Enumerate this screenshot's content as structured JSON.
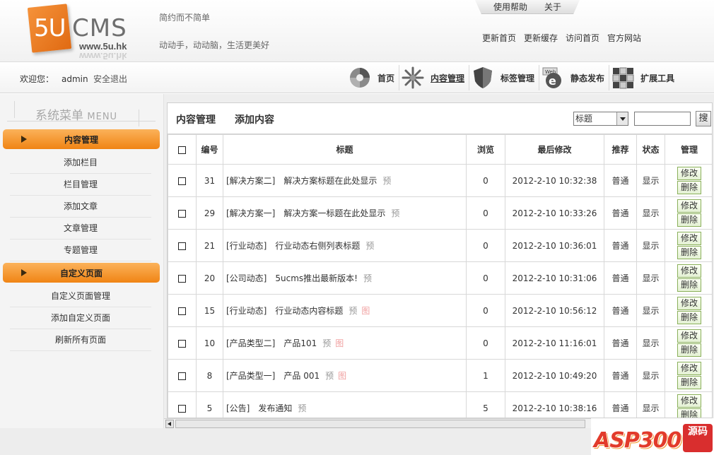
{
  "header": {
    "logo_5u": "5U",
    "logo_cms": "CMS",
    "logo_url": "www.5u.hk",
    "slogan1": "简约而不简单",
    "slogan2": "动动手，动动脑，生活更美好",
    "help_tab": [
      "使用帮助",
      "关于"
    ],
    "quick_links": [
      "更新首页",
      "更新缓存",
      "访问首页",
      "官方网站"
    ]
  },
  "navbar": {
    "welcome": "欢迎您：",
    "user": "admin",
    "logout": "安全退出",
    "items": [
      {
        "label": "首页",
        "icon": "home-icon"
      },
      {
        "label": "内容管理",
        "icon": "content-icon"
      },
      {
        "label": "标签管理",
        "icon": "tag-icon"
      },
      {
        "label": "静态发布",
        "icon": "publish-icon"
      },
      {
        "label": "扩展工具",
        "icon": "tools-icon"
      }
    ]
  },
  "sidebar": {
    "title": "系统菜单",
    "title_en": "MENU",
    "groups": [
      {
        "label": "内容管理",
        "items": [
          "添加栏目",
          "栏目管理",
          "添加文章",
          "文章管理",
          "专题管理"
        ]
      },
      {
        "label": "自定义页面",
        "items": [
          "自定义页面管理",
          "添加自定义页面",
          "刷新所有页面"
        ]
      }
    ]
  },
  "main": {
    "title": "内容管理",
    "add_link": "添加内容",
    "search_select": "标题",
    "search_button": "搜",
    "columns": [
      "编号",
      "标题",
      "浏览",
      "最后修改",
      "推荐",
      "状态",
      "管理"
    ],
    "edit_label": "修改",
    "delete_label": "删除",
    "rows": [
      {
        "id": "31",
        "cat": "[解决方案二]",
        "title": "解决方案标题在此处显示",
        "pre": "预",
        "pic": "",
        "views": "0",
        "modified": "2012-2-10 10:32:38",
        "rec": "普通",
        "status": "显示"
      },
      {
        "id": "29",
        "cat": "[解决方案一]",
        "title": "解决方案一标题在此处显示",
        "pre": "预",
        "pic": "",
        "views": "0",
        "modified": "2012-2-10 10:33:26",
        "rec": "普通",
        "status": "显示"
      },
      {
        "id": "21",
        "cat": "[行业动态]",
        "title": "行业动态右侧列表标题",
        "pre": "预",
        "pic": "",
        "views": "0",
        "modified": "2012-2-10 10:36:01",
        "rec": "普通",
        "status": "显示"
      },
      {
        "id": "20",
        "cat": "[公司动态]",
        "title": "5ucms推出最新版本!",
        "pre": "预",
        "pic": "",
        "views": "0",
        "modified": "2012-2-10 10:31:06",
        "rec": "普通",
        "status": "显示"
      },
      {
        "id": "15",
        "cat": "[行业动态]",
        "title": "行业动态内容标题",
        "pre": "预",
        "pic": "图",
        "views": "0",
        "modified": "2012-2-10 10:56:12",
        "rec": "普通",
        "status": "显示"
      },
      {
        "id": "10",
        "cat": "[产品类型二]",
        "title": "产品101",
        "pre": "预",
        "pic": "图",
        "views": "0",
        "modified": "2012-2-10 11:16:01",
        "rec": "普通",
        "status": "显示"
      },
      {
        "id": "8",
        "cat": "[产品类型一]",
        "title": "产品 001",
        "pre": "预",
        "pic": "图",
        "views": "1",
        "modified": "2012-2-10 10:49:20",
        "rec": "普通",
        "status": "显示"
      },
      {
        "id": "5",
        "cat": "[公告]",
        "title": "发布通知",
        "pre": "预",
        "pic": "",
        "views": "5",
        "modified": "2012-2-10 10:38:16",
        "rec": "普通",
        "status": "显示"
      }
    ]
  },
  "watermark": {
    "text": "ASP300",
    "badge": "源码"
  },
  "colors": {
    "accent_orange": "#f08414",
    "button_green": "#8ab05a"
  }
}
